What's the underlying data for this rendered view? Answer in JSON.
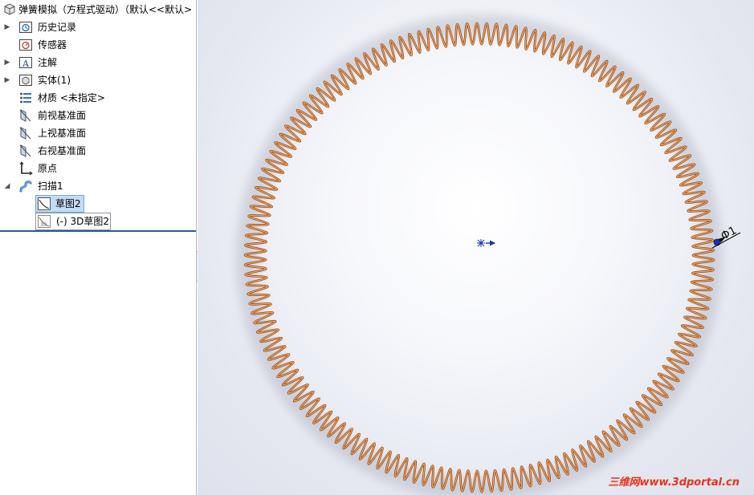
{
  "tree": {
    "root_label": "弹簧模拟（方程式驱动）（默认<<默认>",
    "items": [
      {
        "label": "历史记录",
        "icon": "history-folder-icon"
      },
      {
        "label": "传感器",
        "icon": "sensor-folder-icon"
      },
      {
        "label": "注解",
        "icon": "annotation-icon"
      },
      {
        "label": "实体(1)",
        "icon": "solid-body-folder-icon"
      },
      {
        "label": "材质 <未指定>",
        "icon": "material-icon"
      },
      {
        "label": "前视基准面",
        "icon": "plane-icon"
      },
      {
        "label": "上视基准面",
        "icon": "plane-icon"
      },
      {
        "label": "右视基准面",
        "icon": "plane-icon"
      },
      {
        "label": "原点",
        "icon": "origin-icon"
      },
      {
        "label": "扫描1",
        "icon": "sweep-icon"
      }
    ],
    "children": [
      {
        "label": "草图2",
        "icon": "sketch-icon",
        "selected": true
      },
      {
        "label": "(-) 3D草图2",
        "icon": "3d-sketch-icon"
      }
    ]
  },
  "viewport": {
    "dimension_label": "Φ1",
    "spring_color": "#d9772b",
    "origin_color": "#1a2fb8"
  },
  "watermark": "三维网www.3dportal.cn"
}
